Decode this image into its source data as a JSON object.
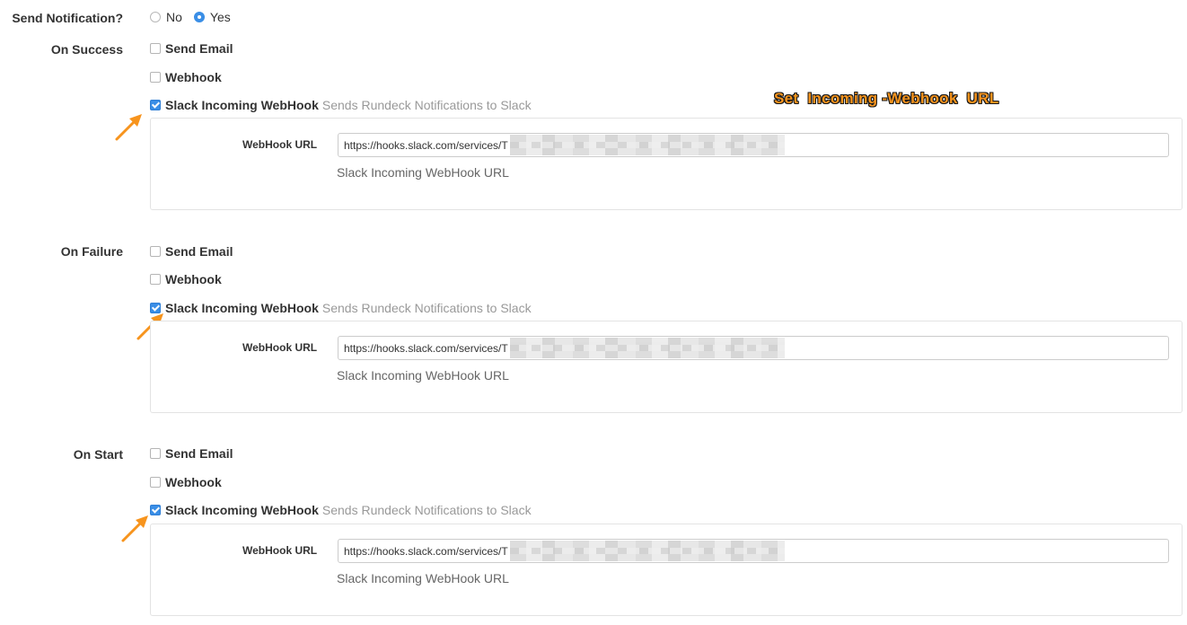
{
  "send_notification": {
    "label": "Send Notification?",
    "options": [
      {
        "label": "No",
        "selected": false
      },
      {
        "label": "Yes",
        "selected": true
      }
    ]
  },
  "annotation": {
    "text": "Set  Incoming -Webhook  URL",
    "color": "#f7941d"
  },
  "sections": [
    {
      "label": "On Success",
      "send_email": {
        "label": "Send Email",
        "checked": false
      },
      "webhook": {
        "label": "Webhook",
        "checked": false
      },
      "slack": {
        "label": "Slack Incoming WebHook",
        "description": "Sends Rundeck Notifications to Slack",
        "checked": true,
        "field_label": "WebHook URL",
        "url_value": "https://hooks.slack.com/services/T",
        "help": "Slack Incoming WebHook URL"
      }
    },
    {
      "label": "On Failure",
      "send_email": {
        "label": "Send Email",
        "checked": false
      },
      "webhook": {
        "label": "Webhook",
        "checked": false
      },
      "slack": {
        "label": "Slack Incoming WebHook",
        "description": "Sends Rundeck Notifications to Slack",
        "checked": true,
        "field_label": "WebHook URL",
        "url_value": "https://hooks.slack.com/services/T",
        "help": "Slack Incoming WebHook URL"
      }
    },
    {
      "label": "On Start",
      "send_email": {
        "label": "Send Email",
        "checked": false
      },
      "webhook": {
        "label": "Webhook",
        "checked": false
      },
      "slack": {
        "label": "Slack Incoming WebHook",
        "description": "Sends Rundeck Notifications to Slack",
        "checked": true,
        "field_label": "WebHook URL",
        "url_value": "https://hooks.slack.com/services/T",
        "help": "Slack Incoming WebHook URL"
      }
    }
  ],
  "colors": {
    "accent": "#3a8ee6",
    "arrow": "#f7941d",
    "muted_text": "#999999"
  },
  "icons": [
    "radio-icon",
    "checkbox-icon",
    "arrow-icon"
  ]
}
